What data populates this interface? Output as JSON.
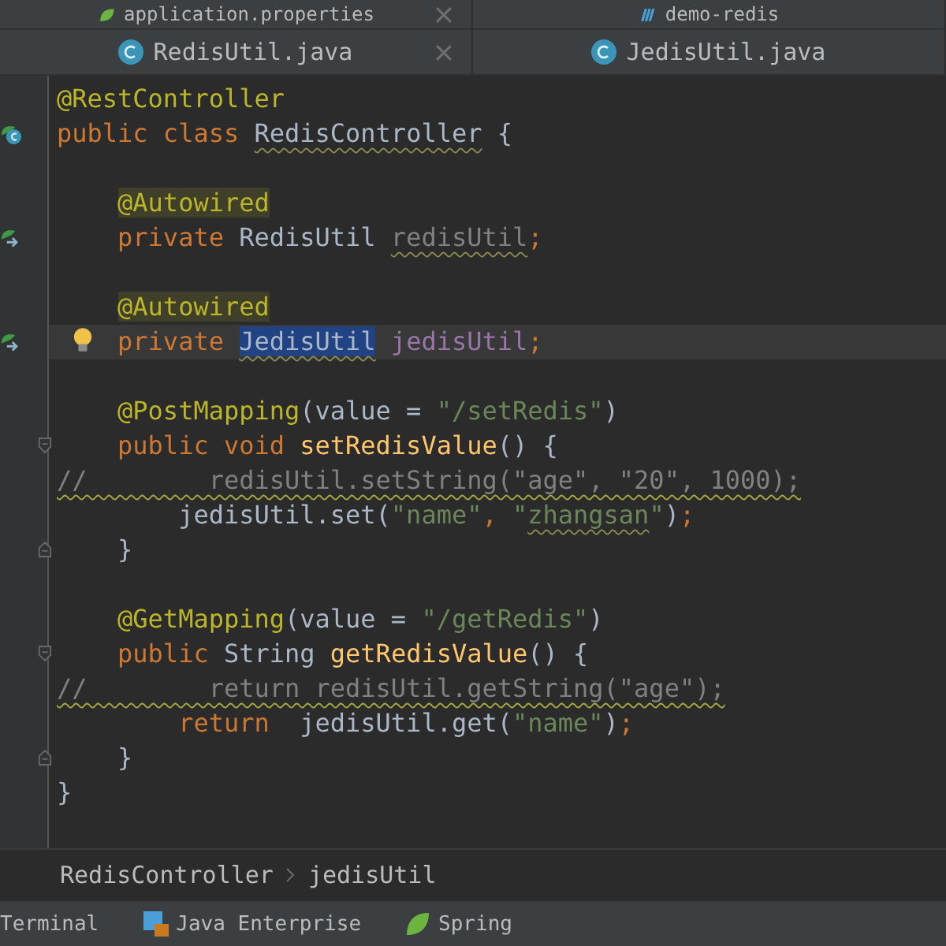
{
  "top_tabs": [
    {
      "label": "application.properties",
      "closable": true
    },
    {
      "label": "demo-redis",
      "closable": false
    }
  ],
  "editor_tabs": [
    {
      "label": "RedisUtil.java",
      "closable": true
    },
    {
      "label": "JedisUtil.java",
      "closable": false
    }
  ],
  "code_lines": [
    {
      "current": false,
      "tokens": [
        {
          "kind": "annotation",
          "t": "@RestController"
        }
      ]
    },
    {
      "current": false,
      "class_marker": true,
      "tokens": [
        {
          "kind": "keyword",
          "t": "public class "
        },
        {
          "kind": "plain",
          "t": "RedisController",
          "wavy": true
        },
        {
          "kind": "plain",
          "t": " {"
        }
      ]
    },
    {
      "current": false
    },
    {
      "current": false,
      "tokens": [
        {
          "kind": "highlighted_annotation",
          "t": "    @Autowired"
        }
      ]
    },
    {
      "current": false,
      "bean_marker": true,
      "tokens": [
        {
          "kind": "keyword",
          "t": "    private "
        },
        {
          "kind": "plain",
          "t": "RedisUtil "
        },
        {
          "kind": "unused",
          "t": "redisUtil",
          "wavy": true
        },
        {
          "kind": "keyword",
          "t": ";"
        }
      ]
    },
    {
      "current": false
    },
    {
      "current": false,
      "tokens": [
        {
          "kind": "highlighted_annotation",
          "t": "    @Autowired"
        }
      ]
    },
    {
      "current": true,
      "bean_marker": true,
      "bulb": true,
      "tokens": [
        {
          "kind": "keyword",
          "t": "    private "
        },
        {
          "kind": "plain",
          "t": "JedisUtil",
          "selected": true,
          "wavy": true
        },
        {
          "kind": "field",
          "t": " jedisUtil"
        },
        {
          "kind": "keyword",
          "t": ";"
        }
      ]
    },
    {
      "current": false
    },
    {
      "current": false,
      "tokens": [
        {
          "kind": "annotation",
          "t": "    @PostMapping"
        },
        {
          "kind": "plain",
          "t": "(value = "
        },
        {
          "kind": "string",
          "t": "\"/setRedis\""
        },
        {
          "kind": "plain",
          "t": ")"
        }
      ]
    },
    {
      "current": false,
      "fold_start": true,
      "tokens": [
        {
          "kind": "keyword",
          "t": "    public void "
        },
        {
          "kind": "method",
          "t": "setRedisValue"
        },
        {
          "kind": "plain",
          "t": "() {"
        }
      ]
    },
    {
      "current": false,
      "tokens": [
        {
          "kind": "comment",
          "t": "//        redisUtil.setString(\"age\", \"20\", 1000);",
          "wavy": true
        }
      ]
    },
    {
      "current": false,
      "tokens": [
        {
          "kind": "plain",
          "t": "        jedisUtil.set("
        },
        {
          "kind": "string",
          "t": "\"name\""
        },
        {
          "kind": "keyword",
          "t": ", "
        },
        {
          "kind": "string",
          "t": "\""
        },
        {
          "kind": "string",
          "t": "zhangsan",
          "wavy": true
        },
        {
          "kind": "string",
          "t": "\""
        },
        {
          "kind": "plain",
          "t": ")"
        },
        {
          "kind": "keyword",
          "t": ";"
        }
      ]
    },
    {
      "current": false,
      "fold_end": true,
      "tokens": [
        {
          "kind": "plain",
          "t": "    }"
        }
      ]
    },
    {
      "current": false
    },
    {
      "current": false,
      "tokens": [
        {
          "kind": "annotation",
          "t": "    @GetMapping"
        },
        {
          "kind": "plain",
          "t": "(value = "
        },
        {
          "kind": "string",
          "t": "\"/getRedis\""
        },
        {
          "kind": "plain",
          "t": ")"
        }
      ]
    },
    {
      "current": false,
      "fold_start": true,
      "tokens": [
        {
          "kind": "keyword",
          "t": "    public "
        },
        {
          "kind": "plain",
          "t": "String "
        },
        {
          "kind": "method",
          "t": "getRedisValue"
        },
        {
          "kind": "plain",
          "t": "() {"
        }
      ]
    },
    {
      "current": false,
      "tokens": [
        {
          "kind": "comment",
          "t": "//        return redisUtil.getString(\"age\");",
          "wavy": true
        }
      ]
    },
    {
      "current": false,
      "tokens": [
        {
          "kind": "keyword",
          "t": "        return  "
        },
        {
          "kind": "plain",
          "t": "jedisUtil.get("
        },
        {
          "kind": "string",
          "t": "\"name\""
        },
        {
          "kind": "plain",
          "t": ")"
        },
        {
          "kind": "keyword",
          "t": ";"
        }
      ]
    },
    {
      "current": false,
      "fold_end": true,
      "tokens": [
        {
          "kind": "plain",
          "t": "    }"
        }
      ]
    },
    {
      "current": false,
      "tokens": [
        {
          "kind": "plain",
          "t": "}"
        }
      ]
    }
  ],
  "breadcrumb": [
    "RedisController",
    "jedisUtil"
  ],
  "tool_windows": [
    "Terminal",
    "Java Enterprise",
    "Spring"
  ]
}
